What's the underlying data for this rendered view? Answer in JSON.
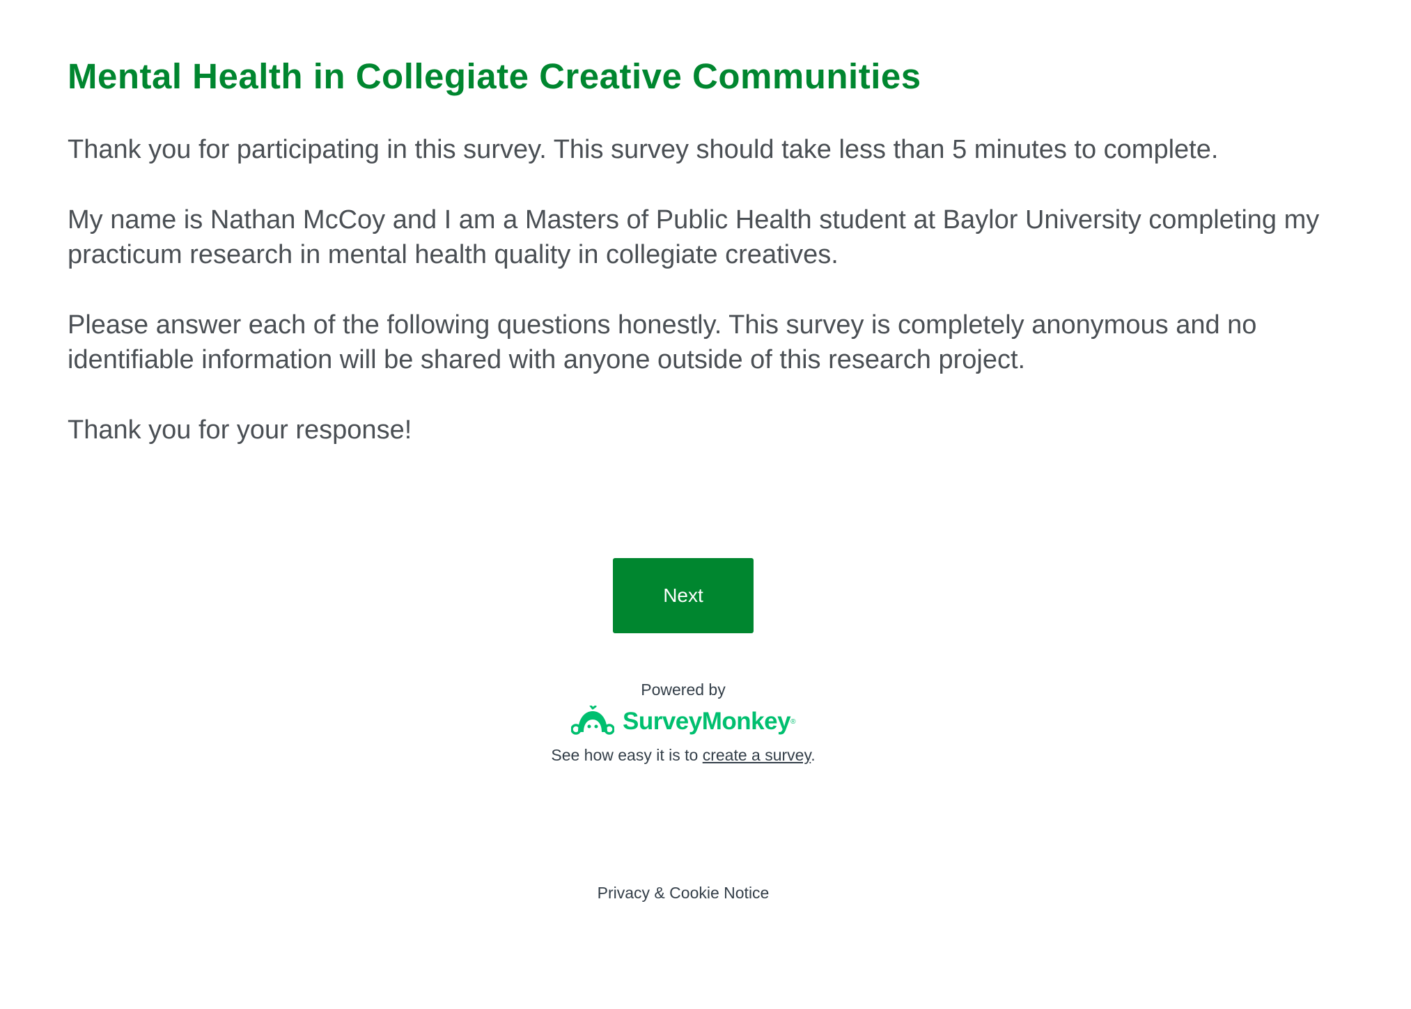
{
  "survey": {
    "title": "Mental Health in Collegiate Creative Communities",
    "paragraphs": [
      "Thank you for participating in this survey. This survey should take less than 5 minutes to complete.",
      "My name is Nathan McCoy and I am a Masters of Public Health student at Baylor University completing my practicum research in mental health quality in collegiate creatives.",
      "Please answer each of the following questions honestly. This survey is completely anonymous and no identifiable information will be shared with anyone outside of this research project.",
      "Thank you for your response!"
    ],
    "next_label": "Next"
  },
  "footer": {
    "powered_by": "Powered by",
    "logo_text": "SurveyMonkey",
    "logo_icon": "surveymonkey-logo-icon",
    "create_prefix": "See how easy it is to ",
    "create_link": "create a survey",
    "create_suffix": ".",
    "privacy": "Privacy & Cookie Notice"
  },
  "colors": {
    "brand_green": "#00862f",
    "logo_green": "#00bf6f",
    "body_text": "#4a4f54",
    "footer_text": "#333e48"
  }
}
